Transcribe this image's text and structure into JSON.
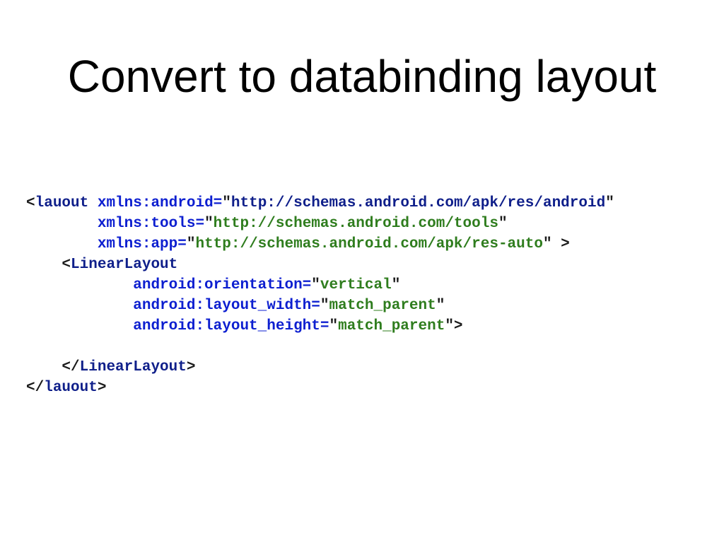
{
  "slide": {
    "title": "Convert to databinding layout"
  },
  "code": {
    "lines": [
      {
        "indent": "",
        "tokens": [
          {
            "type": "punct",
            "text": "<"
          },
          {
            "type": "tag",
            "text": "lauout"
          },
          {
            "type": "punct",
            "text": " "
          },
          {
            "type": "attr",
            "text": "xmlns:android="
          },
          {
            "type": "punct",
            "text": "\""
          },
          {
            "type": "tag",
            "text": "http://schemas.android.com/apk/res/android"
          },
          {
            "type": "punct",
            "text": "\""
          }
        ]
      },
      {
        "indent": "        ",
        "tokens": [
          {
            "type": "attr",
            "text": "xmlns:tools="
          },
          {
            "type": "punct",
            "text": "\""
          },
          {
            "type": "val",
            "text": "http://schemas.android.com/tools"
          },
          {
            "type": "punct",
            "text": "\""
          }
        ]
      },
      {
        "indent": "        ",
        "tokens": [
          {
            "type": "attr",
            "text": "xmlns:app="
          },
          {
            "type": "punct",
            "text": "\""
          },
          {
            "type": "val",
            "text": "http://schemas.android.com/apk/res-auto"
          },
          {
            "type": "punct",
            "text": "\" >"
          }
        ]
      },
      {
        "indent": "    ",
        "tokens": [
          {
            "type": "punct",
            "text": "<"
          },
          {
            "type": "tag",
            "text": "LinearLayout"
          }
        ]
      },
      {
        "indent": "            ",
        "tokens": [
          {
            "type": "attr",
            "text": "android:orientation="
          },
          {
            "type": "punct",
            "text": "\""
          },
          {
            "type": "val",
            "text": "vertical"
          },
          {
            "type": "punct",
            "text": "\""
          }
        ]
      },
      {
        "indent": "            ",
        "tokens": [
          {
            "type": "attr",
            "text": "android:layout_width="
          },
          {
            "type": "punct",
            "text": "\""
          },
          {
            "type": "val",
            "text": "match_parent"
          },
          {
            "type": "punct",
            "text": "\""
          }
        ]
      },
      {
        "indent": "            ",
        "tokens": [
          {
            "type": "attr",
            "text": "android:layout_height="
          },
          {
            "type": "punct",
            "text": "\""
          },
          {
            "type": "val",
            "text": "match_parent"
          },
          {
            "type": "punct",
            "text": "\">"
          }
        ]
      },
      {
        "indent": "",
        "tokens": []
      },
      {
        "indent": "    ",
        "tokens": [
          {
            "type": "punct",
            "text": "</"
          },
          {
            "type": "tag",
            "text": "LinearLayout"
          },
          {
            "type": "punct",
            "text": ">"
          }
        ]
      },
      {
        "indent": "",
        "tokens": [
          {
            "type": "punct",
            "text": "</"
          },
          {
            "type": "tag",
            "text": "lauout"
          },
          {
            "type": "punct",
            "text": ">"
          }
        ]
      }
    ]
  }
}
